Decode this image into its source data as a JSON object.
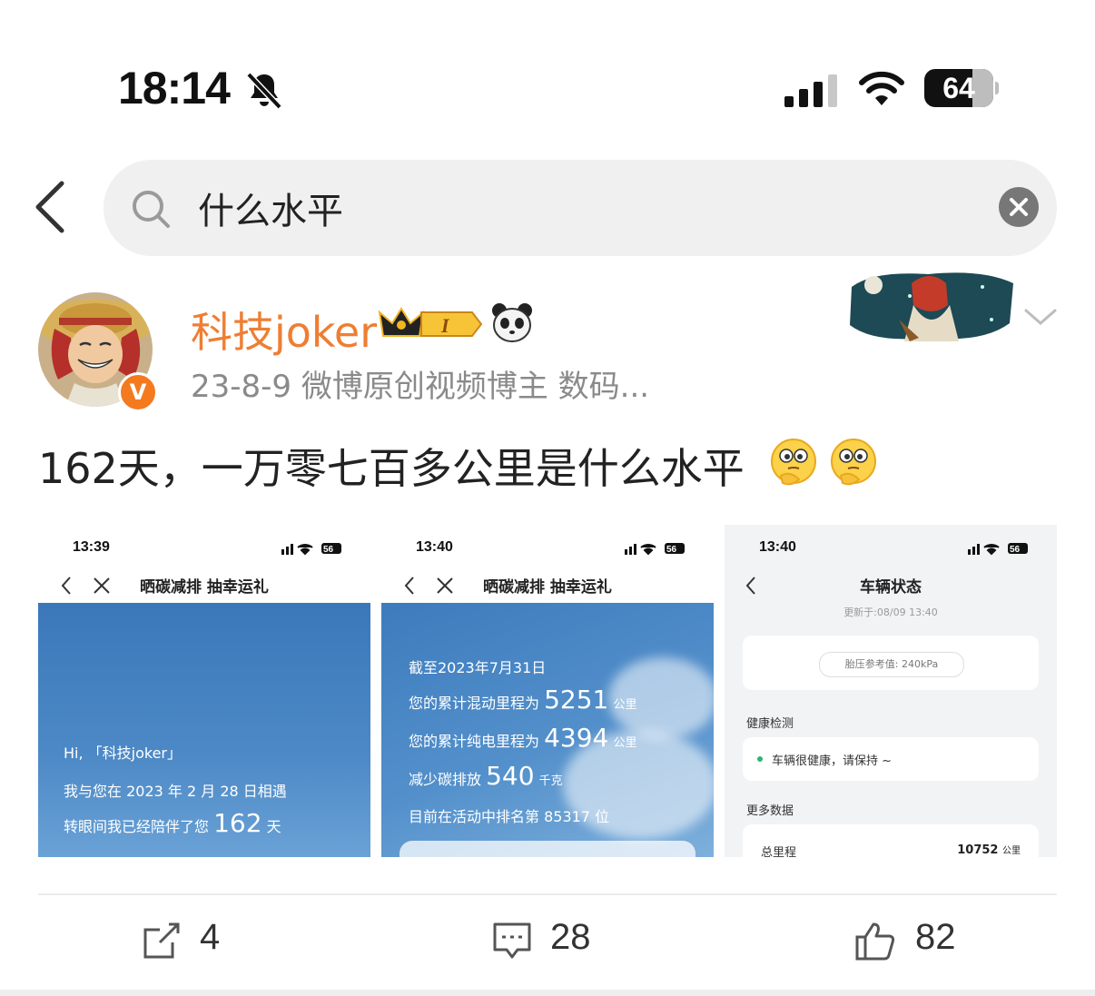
{
  "status_bar": {
    "time": "18:14",
    "battery": "64",
    "battery_level": 0.64
  },
  "search": {
    "query": "什么水平"
  },
  "post": {
    "username": "科技joker",
    "meta": "23-8-9  微博原创视频博主 数码...",
    "text": "162天，一万零七百多公里是什么水平",
    "badge_letter": "I",
    "verified_letter": "V"
  },
  "images": [
    {
      "time": "13:39",
      "battery": "56",
      "title": "晒碳减排 抽幸运礼",
      "lines": {
        "greet": "Hi, 「科技joker」",
        "met_prefix": "我与您在 2023 年 2 月 28 日相遇",
        "days_prefix": "转眼间我已经陪伴了您",
        "days_value": "162",
        "days_unit": "天"
      }
    },
    {
      "time": "13:40",
      "battery": "56",
      "title": "晒碳减排 抽幸运礼",
      "lines": {
        "date": "截至2023年7月31日",
        "hybrid_prefix": "您的累计混动里程为",
        "hybrid_value": "5251",
        "hybrid_unit": "公里",
        "ev_prefix": "您的累计纯电里程为",
        "ev_value": "4394",
        "ev_unit": "公里",
        "carbon_prefix": "减少碳排放",
        "carbon_value": "540",
        "carbon_unit": "千克",
        "rank": "目前在活动中排名第 85317 位"
      }
    },
    {
      "time": "13:40",
      "battery": "56",
      "title": "车辆状态",
      "updated": "更新于:08/09 13:40",
      "tire": "胎压参考值: 240kPa",
      "health_label": "健康检测",
      "health_status": "车辆很健康，请保持 ~",
      "more_label": "更多数据",
      "odometer_label": "总里程",
      "odometer_value": "10752",
      "odometer_unit": "公里"
    }
  ],
  "actions": {
    "share": "4",
    "comments": "28",
    "likes": "82"
  },
  "colors": {
    "username": "#ee7e33",
    "verified": "#f47a20",
    "health_dot": "#2bb673"
  }
}
